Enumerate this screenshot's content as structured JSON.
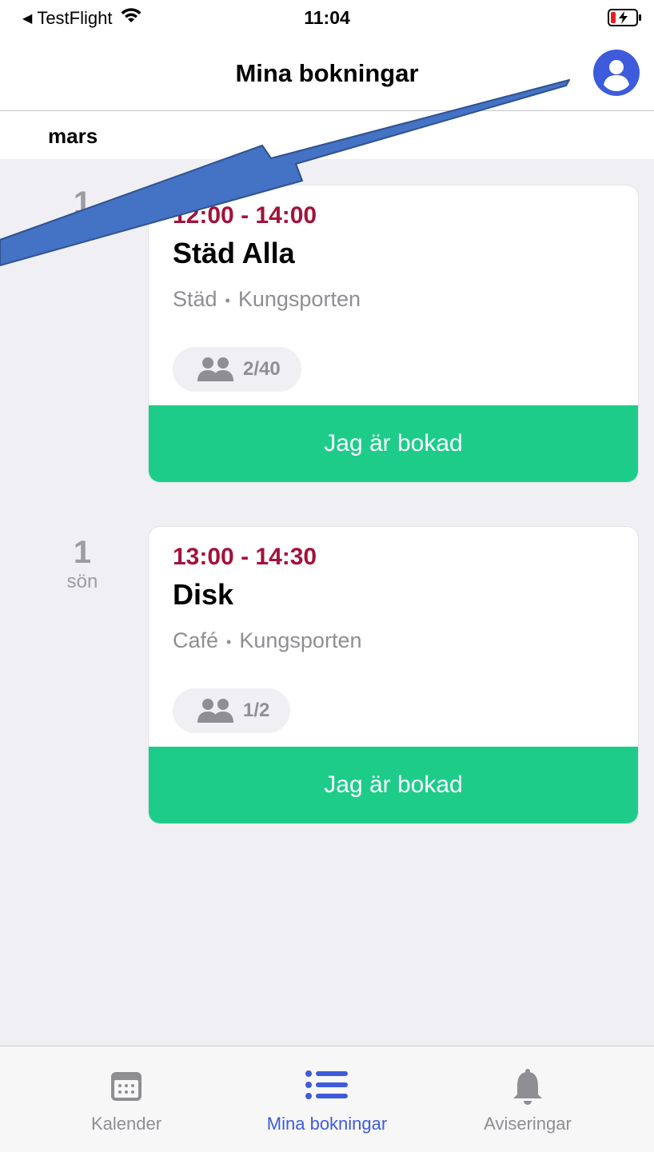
{
  "status_bar": {
    "back_app": "TestFlight",
    "time": "11:04"
  },
  "header": {
    "title": "Mina bokningar",
    "profile_icon": "person-circle-icon"
  },
  "month": "mars",
  "bookings": [
    {
      "day_number": "1",
      "weekday": "sön",
      "time": "12:00 - 14:00",
      "title": "Städ Alla",
      "category": "Städ",
      "separator": "•",
      "location": "Kungsporten",
      "capacity": "2/40",
      "action_label": "Jag är bokad"
    },
    {
      "day_number": "1",
      "weekday": "sön",
      "time": "13:00 - 14:30",
      "title": "Disk",
      "category": "Café",
      "separator": "•",
      "location": "Kungsporten",
      "capacity": "1/2",
      "action_label": "Jag är bokad"
    }
  ],
  "tab_bar": {
    "tabs": [
      {
        "label": "Kalender",
        "icon": "calendar-icon",
        "active": false
      },
      {
        "label": "Mina bokningar",
        "icon": "list-icon",
        "active": true
      },
      {
        "label": "Aviseringar",
        "icon": "bell-icon",
        "active": false
      }
    ]
  },
  "colors": {
    "accent": "#3d5bdb",
    "time_text": "#a3123a",
    "booked_button": "#1ecc8a",
    "background": "#efeff4"
  }
}
